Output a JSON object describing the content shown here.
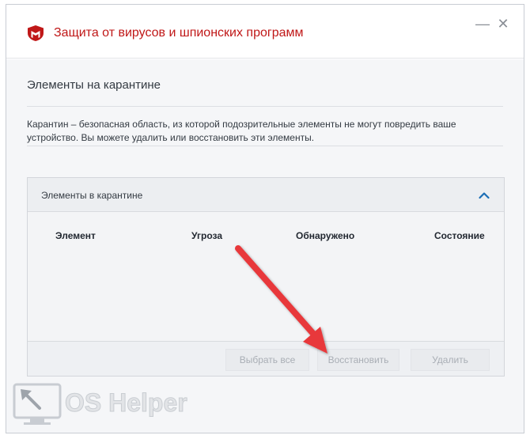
{
  "window": {
    "title": "Защита от вирусов и шпионских программ",
    "minimize_glyph": "—",
    "close_glyph": "✕"
  },
  "colors": {
    "brand": "#c01818",
    "accent": "#1a6db5",
    "annotation_arrow": "#e8373b"
  },
  "icons": [
    "mcafee-shield-icon",
    "minimize-icon",
    "close-icon",
    "chevron-up-icon"
  ],
  "main": {
    "section_title": "Элементы на карантине",
    "description": "Карантин – безопасная область, из которой подозрительные элементы не могут повредить ваше устройство. Вы можете удалить или восстановить эти элементы."
  },
  "panel": {
    "title": "Элементы в карантине",
    "columns": [
      "Элемент",
      "Угроза",
      "Обнаружено",
      "Состояние"
    ],
    "buttons": {
      "select_all": "Выбрать все",
      "restore": "Восстановить",
      "delete": "Удалить"
    }
  },
  "watermark": {
    "text": "OS Helper"
  }
}
